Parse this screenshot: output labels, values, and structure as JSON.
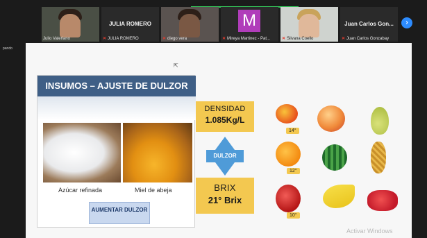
{
  "participants": [
    {
      "name": "Julio Valeriano",
      "muted": false,
      "kind": "video"
    },
    {
      "name": "JULIA ROMERO",
      "muted": true,
      "kind": "name",
      "display": "JULIA ROMERO"
    },
    {
      "name": "diego vera",
      "muted": true,
      "kind": "video"
    },
    {
      "name": "Mireya Martinez - Pat...",
      "muted": true,
      "kind": "avatar",
      "initial": "M"
    },
    {
      "name": "Silvana Coello",
      "muted": true,
      "kind": "video"
    },
    {
      "name": "Juan Carlos Gonzabay",
      "muted": true,
      "kind": "name",
      "display": "Juan Carlos Gon..."
    }
  ],
  "next_button": "›",
  "side_text": "pando",
  "slide": {
    "title": "INSUMOS – AJUSTE DE DULZOR",
    "sugar_caption": "Azúcar refinada",
    "honey_caption": "Miel de abeja",
    "action_button": "AUMENTAR DULZOR",
    "density": {
      "label": "DENSIDAD",
      "value": "1.085Kg/L"
    },
    "dulzor_label": "DULZOR",
    "brix": {
      "label": "BRIX",
      "value": "21° Brix"
    },
    "fruit_tags": [
      "14°",
      "12°",
      "10°"
    ],
    "fruits": [
      "mango",
      "peach",
      "pear",
      "orange",
      "watermelon",
      "pineapple",
      "apple",
      "banana",
      "strawberry"
    ],
    "watermark": "Activar Windows"
  },
  "colors": {
    "title_bar": "#3f5f86",
    "box": "#f3c850",
    "dulzor": "#4f9bd8",
    "accent": "#2d8cff"
  }
}
